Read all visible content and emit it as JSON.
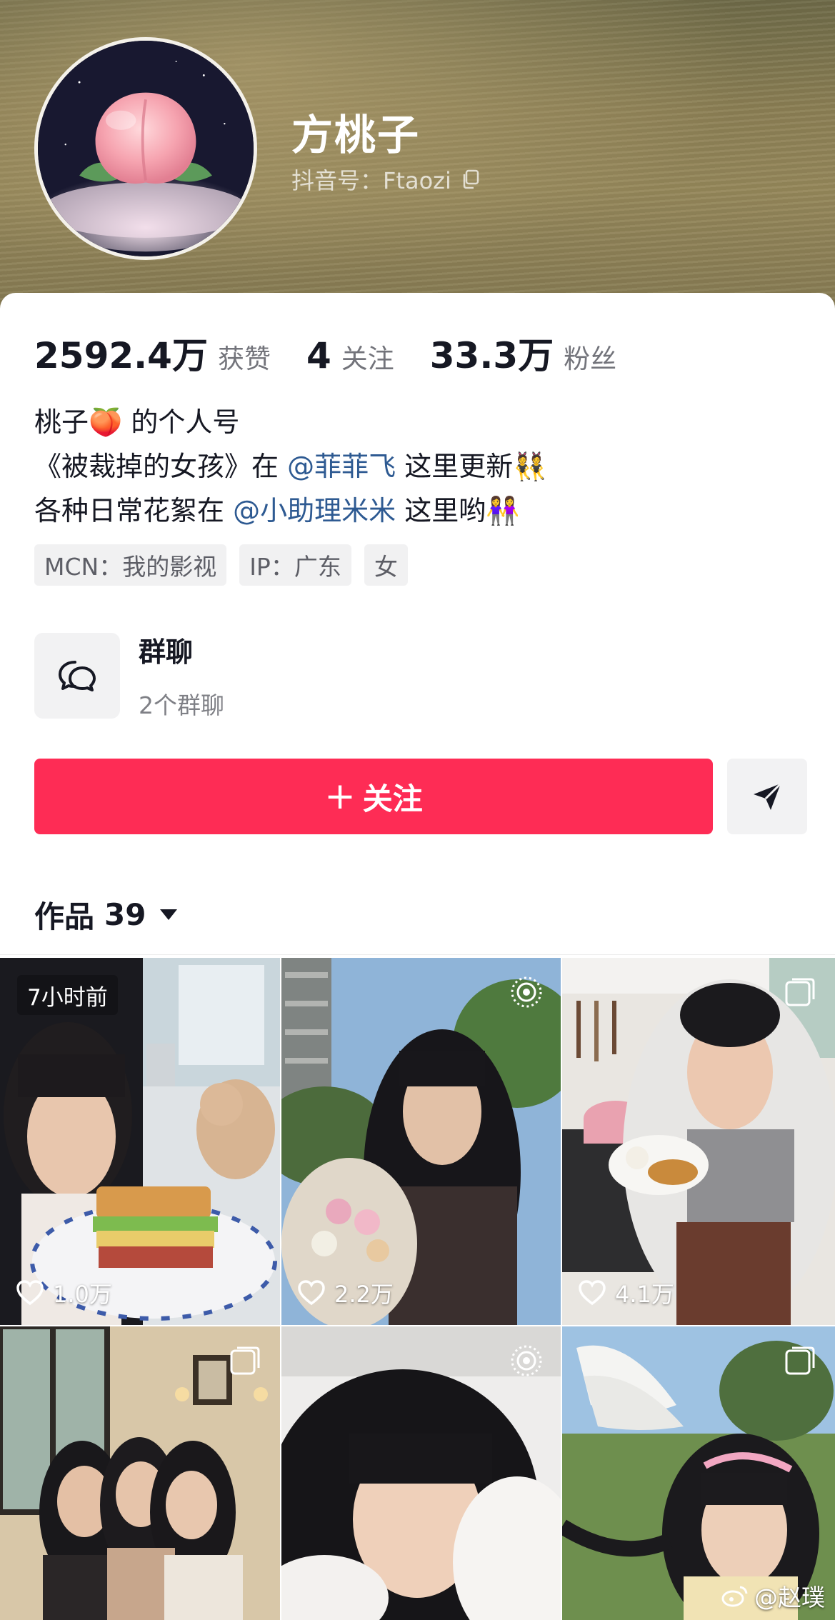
{
  "profile": {
    "nickname": "方桃子",
    "douyin_id": "抖音号：Ftaozi"
  },
  "stats": [
    {
      "value": "2592.4万",
      "label": "获赞"
    },
    {
      "value": "4",
      "label": "关注"
    },
    {
      "value": "33.3万",
      "label": "粉丝"
    }
  ],
  "bio": {
    "line1_a": "桃子",
    "line1_emoji": "🍑",
    "line1_b": " 的个人号",
    "line2_a": "《被裁掉的女孩》在 ",
    "line2_mention": "@菲菲飞",
    "line2_b": " 这里更新",
    "line2_emoji": "👯",
    "line3_a": "各种日常花絮在 ",
    "line3_mention": "@小助理米米",
    "line3_b": " 这里哟",
    "line3_emoji": "👭"
  },
  "tags": [
    "MCN：我的影视",
    "IP：广东",
    "女"
  ],
  "group_chat": {
    "title": "群聊",
    "subtitle": "2个群聊"
  },
  "actions": {
    "follow_label": "关注",
    "follow_plus": "+"
  },
  "works": {
    "label": "作品",
    "count": "39"
  },
  "videos": [
    {
      "badge": "7小时前",
      "likes": "1.0万"
    },
    {
      "likes": "2.2万",
      "icon": "live-photo-icon"
    },
    {
      "likes": "4.1万",
      "icon": "image-post-icon"
    },
    {
      "icon": "image-post-icon"
    },
    {
      "icon": "live-photo-icon"
    },
    {
      "icon": "image-post-icon"
    }
  ],
  "watermark": "@赵璞",
  "colors": {
    "accent": "#fe2c55",
    "mention": "#2e5a92"
  }
}
